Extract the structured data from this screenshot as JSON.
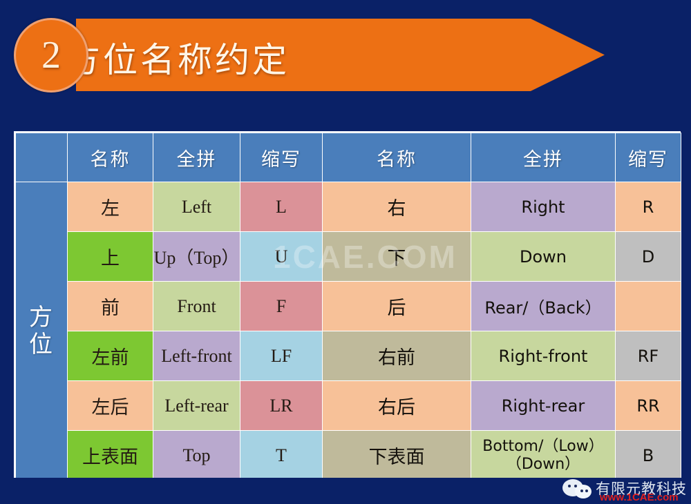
{
  "slide": {
    "background_color": "#0a2167",
    "badge_number": "2",
    "title": "方位名称约定",
    "accent_color": "#ED7014",
    "header_blue": "#4A7EBB"
  },
  "table": {
    "axis_label": "方位",
    "headers": [
      "名称",
      "全拼",
      "缩写",
      "名称",
      "全拼",
      "缩写"
    ],
    "rows": [
      {
        "left_name": "左",
        "left_pinyin": "Left",
        "left_abbr": "L",
        "right_name": "右",
        "right_pinyin": "Right",
        "right_abbr": "R",
        "colors": {
          "left_name": "#F7C198",
          "left_pinyin": "#C7D79E",
          "left_abbr": "#DB9298",
          "right_name": "#F7C198",
          "right_pinyin": "#B9A9CE",
          "right_abbr": "#F7C198"
        }
      },
      {
        "left_name": "上",
        "left_pinyin": "Up（Top）",
        "left_abbr": "U",
        "right_name": "下",
        "right_pinyin": "Down",
        "right_abbr": "D",
        "colors": {
          "left_name": "#7DC832",
          "left_pinyin": "#B9A9CE",
          "left_abbr": "#A5D2E3",
          "right_name": "#BFBA9B",
          "right_pinyin": "#C7D79E",
          "right_abbr": "#BFBFBF"
        }
      },
      {
        "left_name": "前",
        "left_pinyin": "Front",
        "left_abbr": "F",
        "right_name": "后",
        "right_pinyin": "Rear/（Back）",
        "right_abbr": "",
        "colors": {
          "left_name": "#F7C198",
          "left_pinyin": "#C7D79E",
          "left_abbr": "#DB9298",
          "right_name": "#F7C198",
          "right_pinyin": "#B9A9CE",
          "right_abbr": "#F7C198"
        }
      },
      {
        "left_name": "左前",
        "left_pinyin": "Left-front",
        "left_abbr": "LF",
        "right_name": "右前",
        "right_pinyin": "Right-front",
        "right_abbr": "RF",
        "colors": {
          "left_name": "#7DC832",
          "left_pinyin": "#B9A9CE",
          "left_abbr": "#A5D2E3",
          "right_name": "#BFBA9B",
          "right_pinyin": "#C7D79E",
          "right_abbr": "#BFBFBF"
        }
      },
      {
        "left_name": "左后",
        "left_pinyin": "Left-rear",
        "left_abbr": "LR",
        "right_name": "右后",
        "right_pinyin": "Right-rear",
        "right_abbr": "RR",
        "colors": {
          "left_name": "#F7C198",
          "left_pinyin": "#C7D79E",
          "left_abbr": "#DB9298",
          "right_name": "#F7C198",
          "right_pinyin": "#B9A9CE",
          "right_abbr": "#F7C198"
        }
      },
      {
        "left_name": "上表面",
        "left_pinyin": "Top",
        "left_abbr": "T",
        "right_name": "下表面",
        "right_pinyin": "Bottom/（Low）\n（Down）",
        "right_abbr": "B",
        "colors": {
          "left_name": "#7DC832",
          "left_pinyin": "#B9A9CE",
          "left_abbr": "#A5D2E3",
          "right_name": "#BFBA9B",
          "right_pinyin": "#C7D79E",
          "right_abbr": "#BFBFBF"
        }
      }
    ]
  },
  "watermarks": {
    "center": "1CAE.COM",
    "footer_cn": "有限元教科技",
    "footer_url": "www.1CAE.com"
  }
}
